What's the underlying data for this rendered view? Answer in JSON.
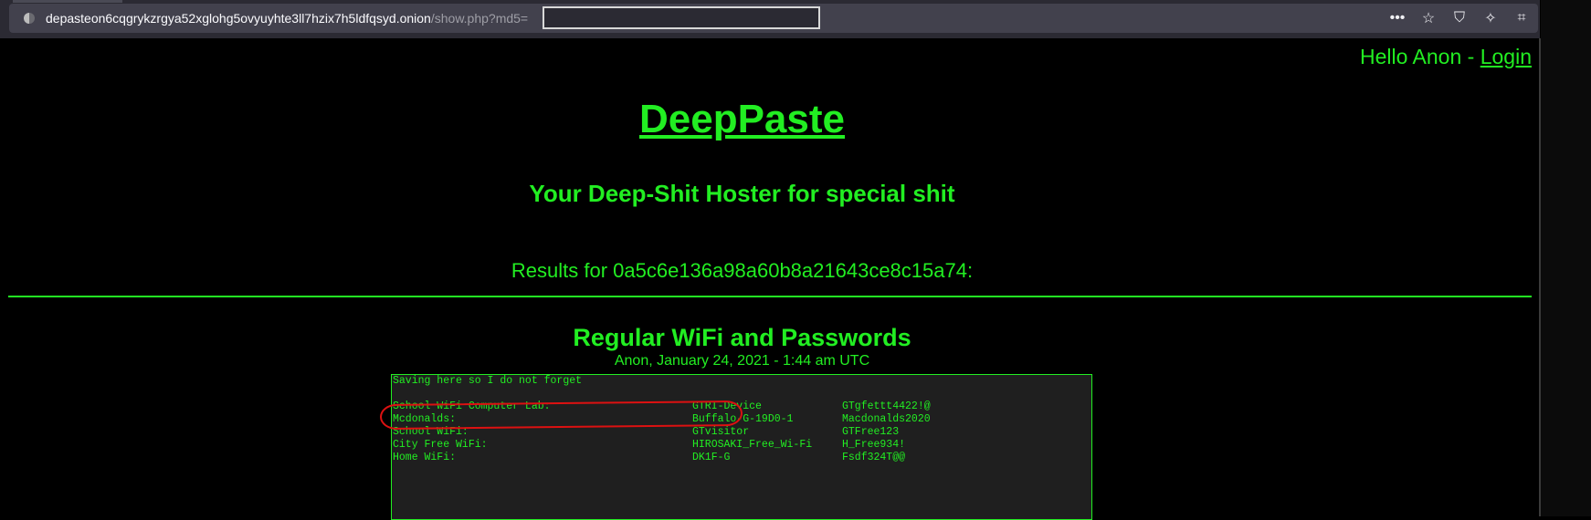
{
  "browser": {
    "url_host": "depasteon6cqgrykzrgya52xglohg5ovyuyhte3ll7hzix7h5ldfqsyd.onion",
    "url_path": "/show.php?md5=",
    "icons": [
      "more-icon",
      "bookmark-star-icon",
      "shield-icon",
      "magic-wand-icon",
      "crop-icon"
    ]
  },
  "header": {
    "greeting": "Hello Anon - ",
    "login_label": "Login"
  },
  "site": {
    "title": "DeepPaste",
    "tagline": "Your Deep-Shit Hoster for special shit",
    "results": "Results for 0a5c6e136a98a60b8a21643ce8c15a74:"
  },
  "paste": {
    "title": "Regular WiFi and Passwords",
    "meta": "Anon, January 24, 2021 - 1:44 am UTC",
    "intro": "Saving here so I do not forget",
    "rows": [
      {
        "label": "School WiFi Computer Lab:",
        "ssid": "GTRI-Device",
        "password": "GTgfettt4422!@"
      },
      {
        "label": "Mcdonalds:",
        "ssid": "Buffalo-G-19D0-1",
        "password": "Macdonalds2020"
      },
      {
        "label": "School WiFi:",
        "ssid": "GTvisitor",
        "password": "GTFree123"
      },
      {
        "label": "City Free WiFi:",
        "ssid": "HIROSAKI_Free_Wi-Fi",
        "password": "H_Free934!"
      },
      {
        "label": "Home WiFi:",
        "ssid": "DK1F-G",
        "password": "Fsdf324T@@"
      }
    ]
  },
  "colors": {
    "accent": "#22ee22",
    "background": "#000000",
    "annotation": "#dd1111"
  }
}
